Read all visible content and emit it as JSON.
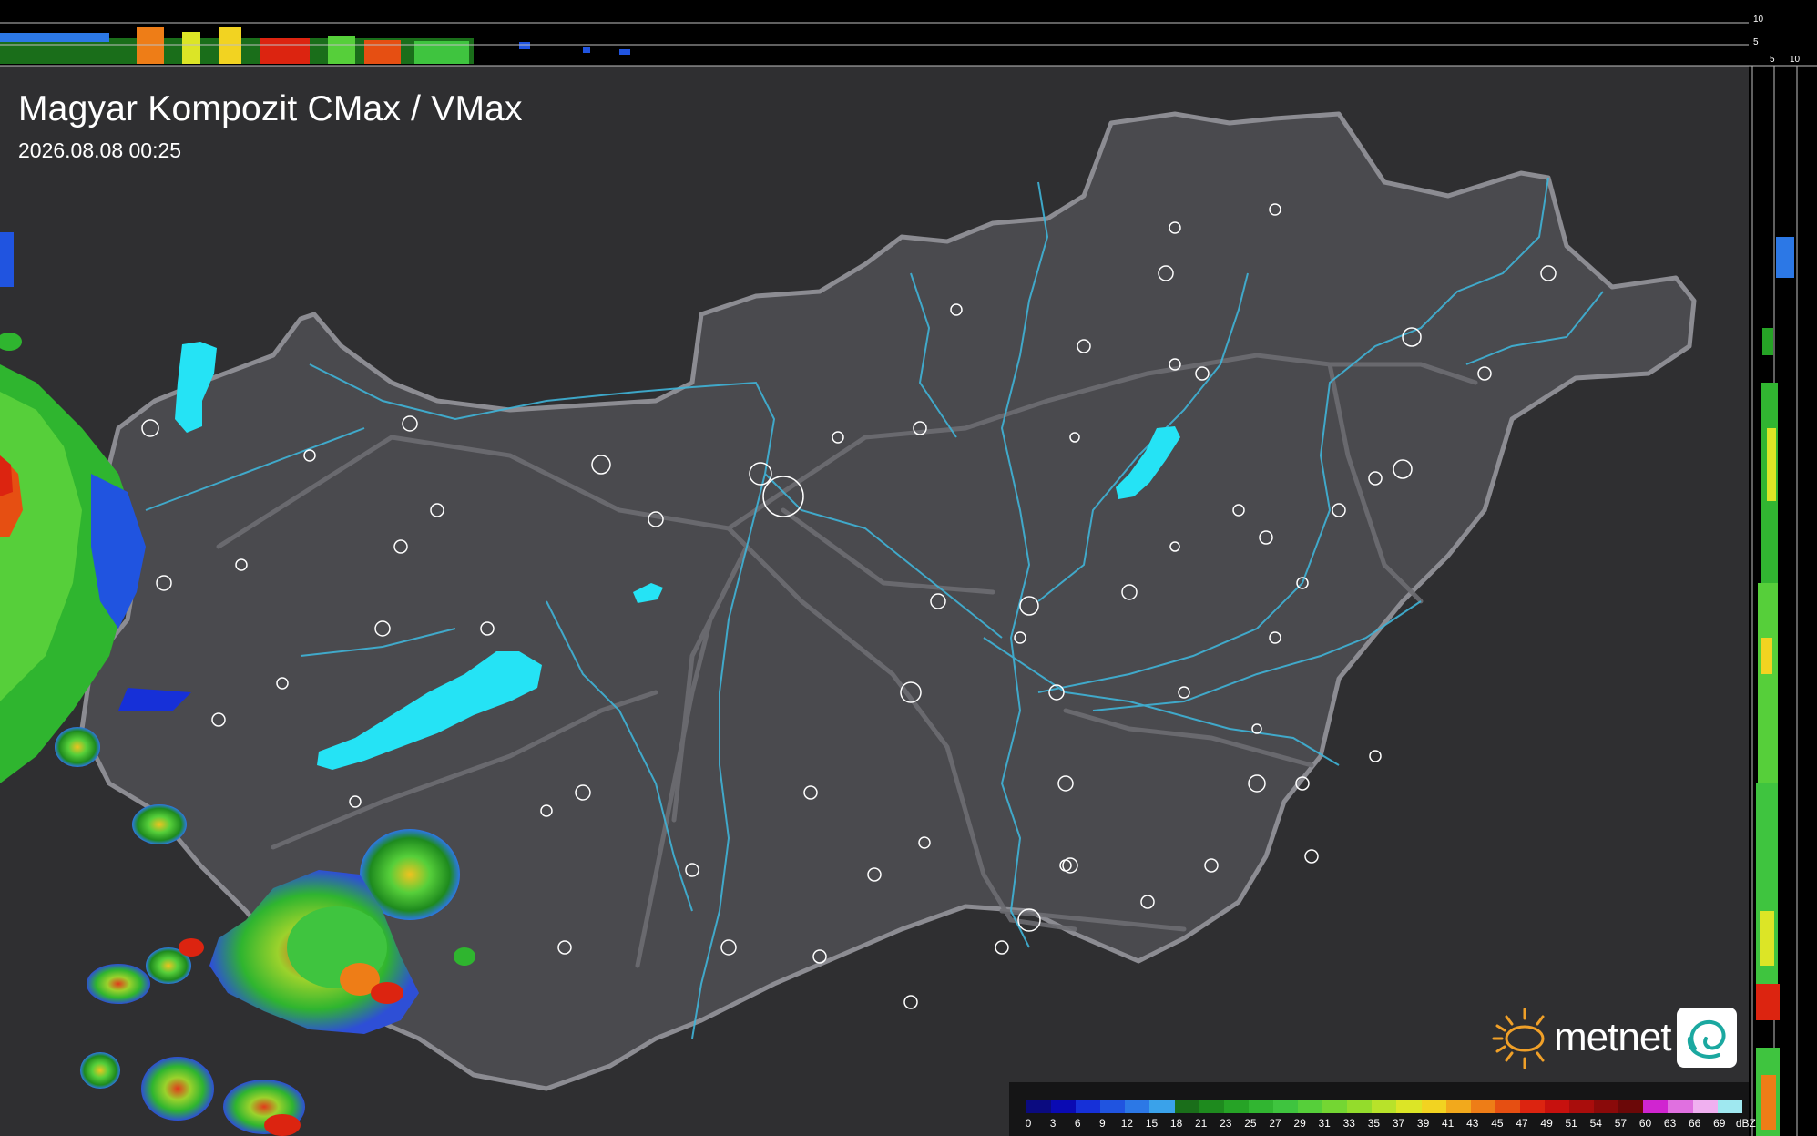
{
  "title": "Magyar Kompozit CMax / VMax",
  "datetime": "2026.08.08 00:25",
  "top_scale": {
    "a": "10",
    "b": "5"
  },
  "side_scale": {
    "a": "5",
    "b": "10"
  },
  "legend": {
    "unit": "dBZ",
    "ticks": [
      "0",
      "3",
      "6",
      "9",
      "12",
      "15",
      "18",
      "21",
      "23",
      "25",
      "27",
      "29",
      "31",
      "33",
      "35",
      "37",
      "39",
      "41",
      "43",
      "45",
      "47",
      "49",
      "51",
      "54",
      "57",
      "60",
      "63",
      "66",
      "69"
    ],
    "colors": [
      "#0b0b80",
      "#0a0ab3",
      "#1630d8",
      "#2054e0",
      "#2c78e6",
      "#3aa2ea",
      "#1a6e1a",
      "#1e8a1e",
      "#26a326",
      "#31b531",
      "#3fc43f",
      "#56cf3a",
      "#74d633",
      "#94dc2c",
      "#b8e22a",
      "#dce526",
      "#f2d321",
      "#f2a91c",
      "#ee7d17",
      "#e64f12",
      "#dc2410",
      "#c7110e",
      "#a90d0c",
      "#8a0a0a",
      "#6b0808",
      "#d025d0",
      "#e070e0",
      "#f0b0f0",
      "#9fe8f0"
    ]
  },
  "brand": {
    "name": "metnet"
  },
  "colors": {
    "background": "#2f2f31",
    "country_fill": "#4a4a4e",
    "border": "#8c8c92",
    "rivers": "#3fb4d8",
    "lakes": "#25e3f5",
    "towns": "#ffffff"
  }
}
